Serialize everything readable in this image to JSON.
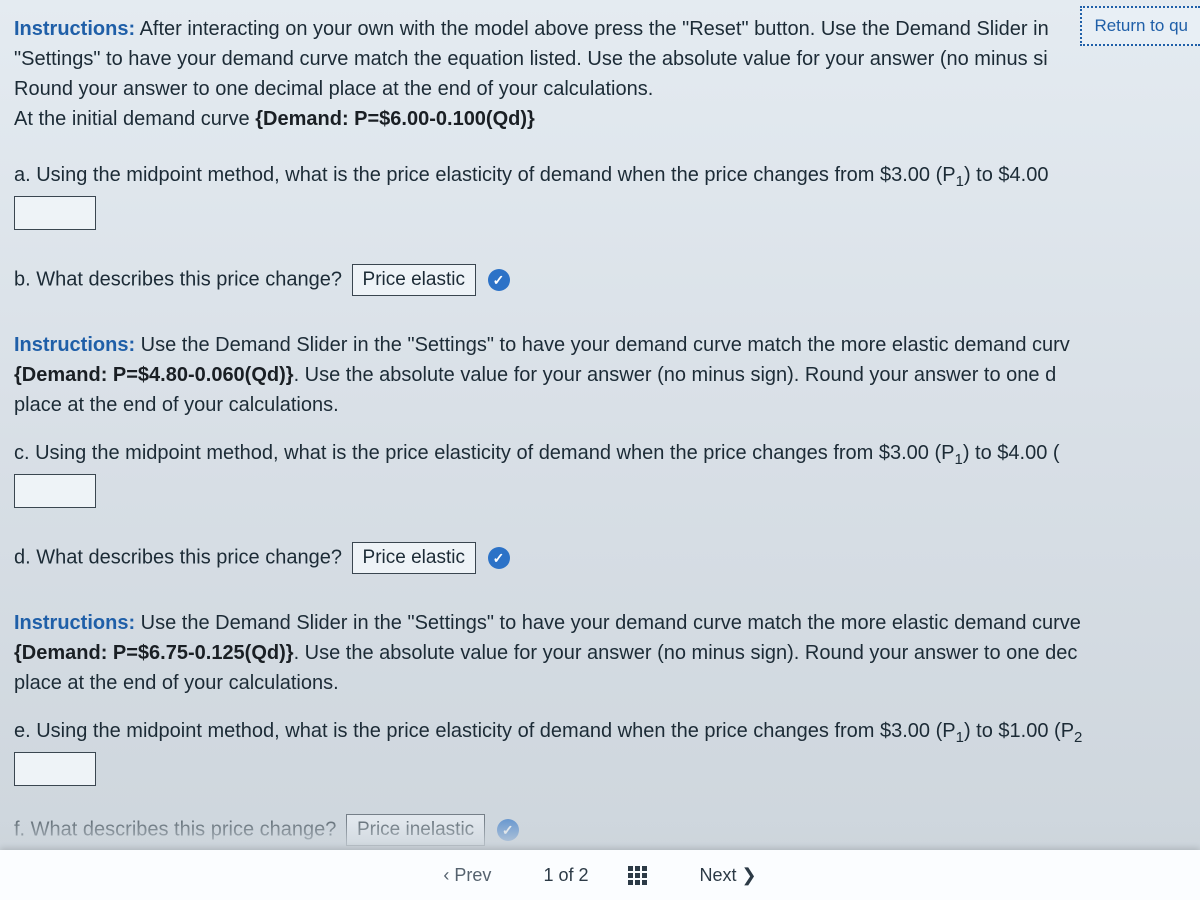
{
  "return_button": "Return to qu",
  "section1": {
    "label": "Instructions:",
    "text_line1": " After interacting on your own with the model above press the \"Reset\" button. Use the Demand Slider in ",
    "text_line2": "\"Settings\" to have your demand curve match the equation listed.  Use the absolute value for your answer (no minus si",
    "text_line3": "Round your answer to one decimal place at the end of your calculations.",
    "text_line4_pre": "At the initial demand curve ",
    "eq1": "{Demand: P=$6.00-0.100(Qd)}"
  },
  "qa": {
    "prefix": "a.  Using the midpoint method, what is the price elasticity of demand when the price changes from $3.00 (P",
    "sub": "1",
    "suffix": ") to $4.00"
  },
  "qb": {
    "prefix": "b. What describes this price change?",
    "value": "Price elastic"
  },
  "section2": {
    "label": "Instructions:",
    "line1": " Use the Demand Slider in the \"Settings\" to have your demand curve match the more elastic demand curv",
    "eq": "{Demand: P=$4.80-0.060(Qd)}",
    "line2_after_eq": ".  Use the absolute value for your answer (no minus sign).   Round your answer to one d",
    "line3": "place at the end of your calculations."
  },
  "qc": {
    "prefix": "c. Using the midpoint method, what is the price elasticity of demand when the price changes from $3.00 (P",
    "sub": "1",
    "suffix": ") to $4.00 ("
  },
  "qd": {
    "prefix": "d. What describes this price change?",
    "value": "Price elastic"
  },
  "section3": {
    "label": "Instructions:",
    "line1": " Use the Demand Slider in the \"Settings\" to have your demand curve match the more elastic demand curve",
    "eq": "{Demand: P=$6.75-0.125(Qd)}",
    "line2_after_eq": ".  Use the absolute value for your answer (no minus sign).  Round your answer to one dec",
    "line3": "place at the end of your calculations."
  },
  "qe": {
    "prefix": "e. Using the midpoint method, what is the price elasticity of demand when the price changes from $3.00 (P",
    "sub": "1",
    "suffix": ") to $1.00 (P",
    "sub2": "2"
  },
  "qf": {
    "prefix": "f. What describes this price change?",
    "value": "Price inelastic"
  },
  "nav": {
    "prev": "Prev",
    "count": "1 of 2",
    "next": "Next  ❯"
  }
}
